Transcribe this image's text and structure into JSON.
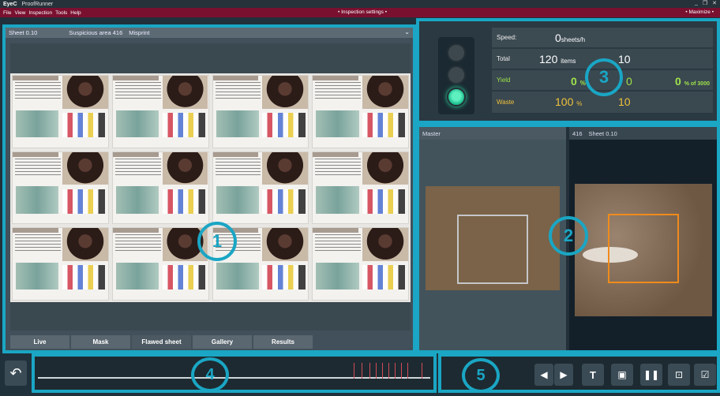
{
  "window": {
    "logo": "EyeC",
    "title": "ProofRunner",
    "controls": [
      "_",
      "❐",
      "✕"
    ]
  },
  "menu": {
    "items": [
      "File",
      "View",
      "Inspection",
      "Tools",
      "Help"
    ],
    "center": "• Inspection settings •",
    "right": "• Maximize •"
  },
  "sheet": {
    "title": "Sheet  0.10",
    "area": "Suspicious area 416",
    "type": "Misprint",
    "tabs": [
      "Live",
      "Mask",
      "Flawed sheet",
      "Gallery",
      "Results"
    ],
    "active_tab": "Flawed sheet",
    "callout": "1"
  },
  "stats": {
    "speed_label": "Speed:",
    "speed_value": "0",
    "speed_unit": "sheets/h",
    "total_label": "Total",
    "total_value": "120",
    "total_unit": "items",
    "total_extra": "10",
    "yield_label": "Yield",
    "yield_pct": "0",
    "yield_pct_unit": "%",
    "yield_mid": "0",
    "yield_right": "0",
    "yield_right_unit": "% of 3000",
    "waste_label": "Waste",
    "waste_pct": "100",
    "waste_pct_unit": "%",
    "waste_value": "10",
    "callout": "3"
  },
  "compare": {
    "master_label": "Master",
    "flaw_id": "416",
    "flaw_sheet": "Sheet  0.10",
    "callout": "2"
  },
  "timeline": {
    "callout": "4"
  },
  "toolbar": {
    "callout": "5",
    "prev_label": "◀",
    "next_label": "▶",
    "text_label": "T",
    "image_label": "▣",
    "split_label": "❚❚",
    "snapshot_label": "⊡",
    "clipboard_label": "☑"
  },
  "back": {
    "label": "↶"
  }
}
